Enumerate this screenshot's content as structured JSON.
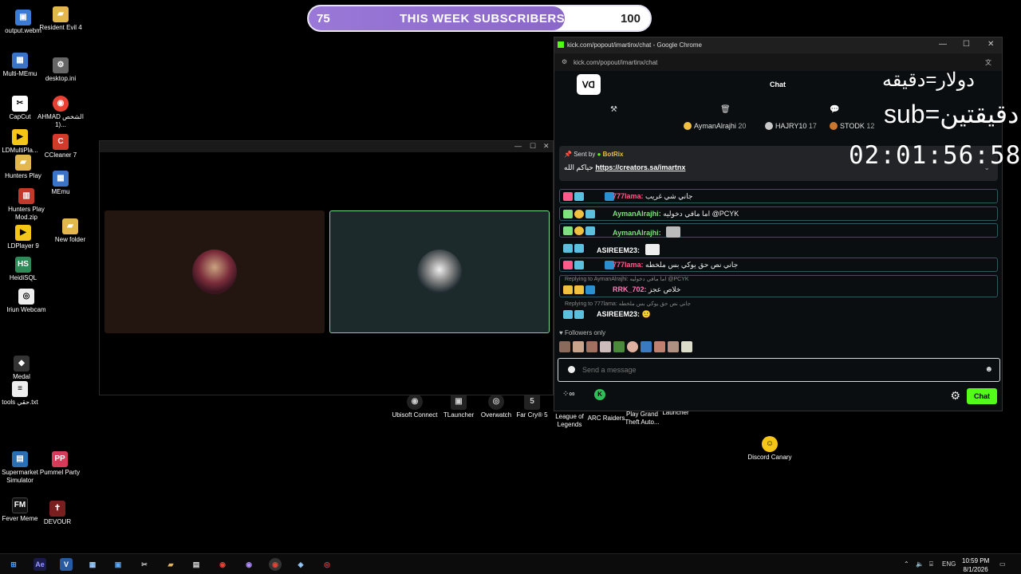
{
  "desktop_icons": [
    {
      "label": "output.webm",
      "x": 0,
      "color": "#3a7bd5",
      "glyph": "▣"
    },
    {
      "label": "Resident Evil 4",
      "color": "#e2b84c",
      "glyph": "▰"
    },
    {
      "label": "Multi-MEmu",
      "color": "#3b73c8",
      "glyph": "▦"
    },
    {
      "label": "desktop.ini",
      "color": "#666",
      "glyph": "⚙"
    },
    {
      "label": "CapCut",
      "color": "#fff",
      "glyph": "✂"
    },
    {
      "label": "AHMAD الشخص (1...",
      "color": "#e94235",
      "glyph": "◉"
    },
    {
      "label": "LDMultiPla...",
      "color": "#f5c518",
      "glyph": "▶"
    },
    {
      "label": "CCleaner 7",
      "color": "#d23a2a",
      "glyph": "C"
    },
    {
      "label": "Hunters Play",
      "color": "#e2b84c",
      "glyph": "▰"
    },
    {
      "label": "MEmu",
      "color": "#3b73c8",
      "glyph": "▦"
    },
    {
      "label": "Hunters Play Mod.zip",
      "color": "#c0392b",
      "glyph": "▥"
    },
    {
      "label": "LDPlayer 9",
      "color": "#f5c518",
      "glyph": "▶"
    },
    {
      "label": "New folder",
      "color": "#e2b84c",
      "glyph": "▰"
    },
    {
      "label": "HeidiSQL",
      "color": "#2e8b57",
      "glyph": "HS"
    },
    {
      "label": "Iriun Webcam",
      "color": "#eee",
      "glyph": "◎"
    },
    {
      "label": "Medal",
      "color": "#333",
      "glyph": "◆"
    },
    {
      "label": "tools حقي.txt",
      "color": "#eee",
      "glyph": "≡"
    },
    {
      "label": "Supermarket Simulator",
      "color": "#2a6fb0",
      "glyph": "▤"
    },
    {
      "label": "Pummel Party",
      "color": "#d63b5a",
      "glyph": "PP"
    },
    {
      "label": "Fever Meme",
      "color": "#111",
      "glyph": "FM"
    },
    {
      "label": "DEVOUR",
      "color": "#7a1f1f",
      "glyph": "✝"
    },
    {
      "label": "Ubisoft Connect",
      "color": "#ccc",
      "glyph": "◉"
    },
    {
      "label": "TLauncher",
      "color": "#ccc",
      "glyph": "▣"
    },
    {
      "label": "Overwatch",
      "color": "#ccc",
      "glyph": "◎"
    },
    {
      "label": "Far Cry® 5",
      "color": "#ccc",
      "glyph": "5"
    },
    {
      "label": "League of Legends",
      "color": "#ccc",
      "glyph": ""
    },
    {
      "label": "ARC Raiders",
      "color": "#ccc",
      "glyph": ""
    },
    {
      "label": "Play Grand Theft Auto...",
      "color": "#ccc",
      "glyph": ""
    },
    {
      "label": "Launcher",
      "color": "#ccc",
      "glyph": ""
    },
    {
      "label": "Discord Canary",
      "color": "#f5c518",
      "glyph": "☺"
    }
  ],
  "goal": {
    "current": "75",
    "title": "THIS WEEK SUBSCRIBERS",
    "target": "100",
    "progress": 0.75
  },
  "call_window": {
    "min": "—",
    "max": "☐",
    "close": "✕"
  },
  "browser": {
    "title": "kick.com/popout/imartinx/chat - Google Chrome",
    "url": "kick.com/popout/imartinx/chat",
    "min": "—",
    "max": "☐",
    "close": "✕"
  },
  "chat": {
    "logo": "ᐯᗡ",
    "header": "Chat",
    "gifters": [
      {
        "name": "AymanAlrajhi",
        "count": "20",
        "color": "#f0c040"
      },
      {
        "name": "HAJRY10",
        "count": "17",
        "color": "#c9c9c9"
      },
      {
        "name": "STODK",
        "count": "12",
        "color": "#c9772e"
      }
    ],
    "pinned": {
      "sent_by": "Sent by",
      "bot": "BotRix",
      "prefix": "حياكم الله",
      "link": "https://creators.sa/imartnx"
    },
    "messages": [
      {
        "user": "777lama",
        "color": "#ff5a8a",
        "text": "جاني شي غريب",
        "reply": ""
      },
      {
        "user": "AymanAlrajhi",
        "color": "#7ee07e",
        "text": "اما مافي دخوليه @PCYK",
        "reply": ""
      },
      {
        "user": "AymanAlrajhi",
        "color": "#7ee07e",
        "text": "",
        "reply": ""
      },
      {
        "user": "ASIREEM23",
        "color": "#ffffff",
        "text": "",
        "reply": ""
      },
      {
        "user": "777lama",
        "color": "#ff5a8a",
        "text": "جاني نص حق يوكي بس ملخطه",
        "reply": ""
      },
      {
        "user": "RRK_702",
        "color": "#ff7ab8",
        "text": "خلاص عجز",
        "reply": "Replying to AymanAlrajhi: اما مافي دخوليه @PCYK"
      },
      {
        "user": "ASIREEM23",
        "color": "#ffffff",
        "text": "🙂",
        "reply": "Replying to 777lama: جاني نص حق يوكي بس ملخطه"
      }
    ],
    "followers_only": "♥ Followers only",
    "input_placeholder": "Send a message",
    "send_label": "Chat"
  },
  "overlay": {
    "line1": "دولار=دقيقه",
    "line2": "sub=دقيقتين",
    "timer": "02:01:56:58"
  },
  "taskbar": {
    "lang": "ENG",
    "time": "10:59 PM",
    "date": "8/1/2026"
  }
}
